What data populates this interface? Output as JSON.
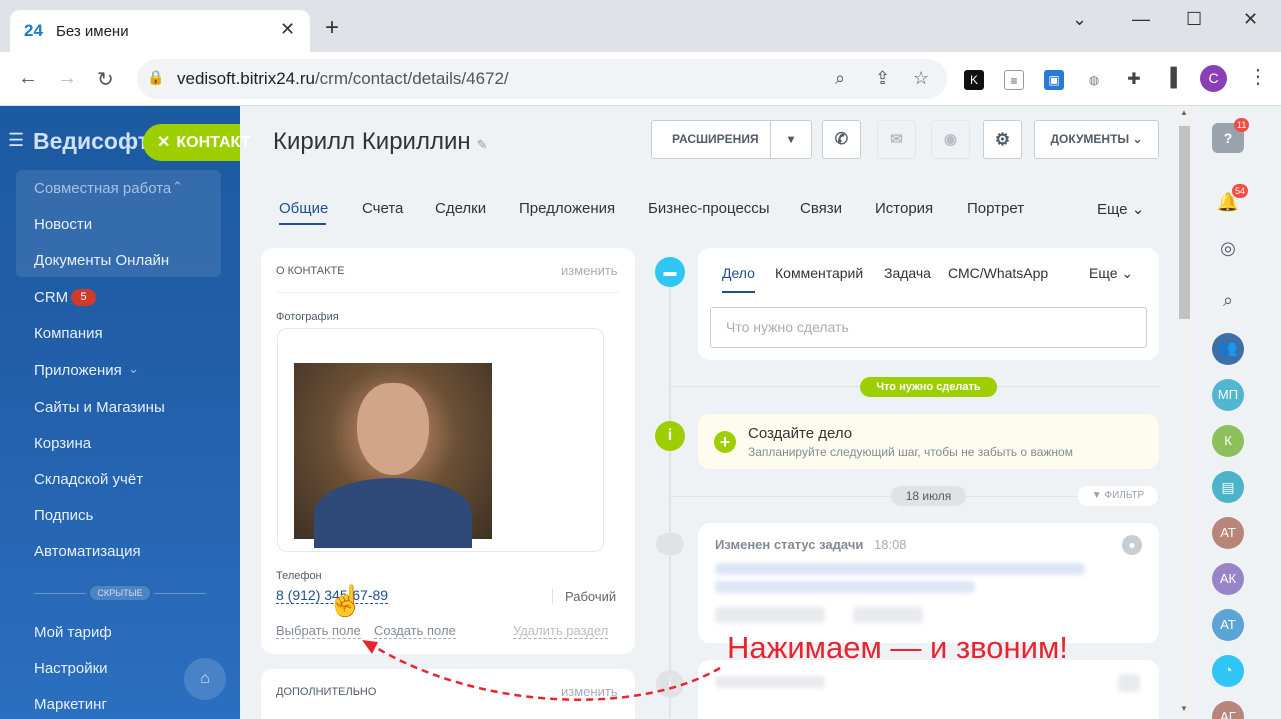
{
  "browser": {
    "tab_logo": "24",
    "tab_title": "Без имени",
    "url_domain": "vedisoft.bitrix24.ru",
    "url_path": "/crm/contact/details/4672/",
    "profile_initial": "C"
  },
  "sidebar": {
    "brand": "Ведисофт",
    "contact_chip": "КОНТАКТ",
    "items": [
      {
        "label": "Совместная работа"
      },
      {
        "label": "Новости"
      },
      {
        "label": "Документы Онлайн"
      },
      {
        "label": "CRM"
      },
      {
        "label": "Компания"
      },
      {
        "label": "Приложения"
      },
      {
        "label": "Сайты и Магазины"
      },
      {
        "label": "Корзина"
      },
      {
        "label": "Складской учёт"
      },
      {
        "label": "Подпись"
      },
      {
        "label": "Автоматизация"
      },
      {
        "label": "Мой тариф"
      },
      {
        "label": "Настройки"
      },
      {
        "label": "Маркетинг"
      }
    ],
    "crm_badge": "5",
    "hidden_label": "СКРЫТЫЕ"
  },
  "header": {
    "contact_name": "Кирилл Кириллин",
    "extensions_label": "РАСШИРЕНИЯ",
    "documents_label": "ДОКУМЕНТЫ"
  },
  "tabs": [
    {
      "label": "Общие"
    },
    {
      "label": "Счета"
    },
    {
      "label": "Сделки"
    },
    {
      "label": "Предложения"
    },
    {
      "label": "Бизнес-процессы"
    },
    {
      "label": "Связи"
    },
    {
      "label": "История"
    },
    {
      "label": "Портрет"
    },
    {
      "label": "Еще"
    }
  ],
  "about": {
    "title": "О КОНТАКТЕ",
    "edit": "изменить",
    "photo_label": "Фотография",
    "phone_label": "Телефон",
    "phone": "8 (912) 345-67-89",
    "phone_type": "Рабочий",
    "choose_field": "Выбрать поле",
    "create_field": "Создать поле",
    "delete_section": "Удалить раздел"
  },
  "extra": {
    "title": "ДОПОЛНИТЕЛЬНО",
    "edit": "изменить"
  },
  "composer": {
    "tabs": [
      {
        "label": "Дело"
      },
      {
        "label": "Комментарий"
      },
      {
        "label": "Задача"
      },
      {
        "label": "СМС/WhatsApp"
      },
      {
        "label": "Еще"
      }
    ],
    "placeholder": "Что нужно сделать"
  },
  "timeline": {
    "todo_pill": "Что нужно сделать",
    "create_title": "Создайте дело",
    "create_sub": "Запланируйте следующий шаг, чтобы не забыть о важном",
    "date_pill": "18 июля",
    "filter": "ФИЛЬТР",
    "event_title": "Изменен статус задачи",
    "event_time": "18:08"
  },
  "rightbar": {
    "help_badge": "11",
    "notif_badge": "54",
    "avatars": [
      "МП",
      "К",
      "АТ",
      "АК",
      "АТ",
      "АГ"
    ]
  },
  "annotation": "Нажимаем — и звоним!"
}
